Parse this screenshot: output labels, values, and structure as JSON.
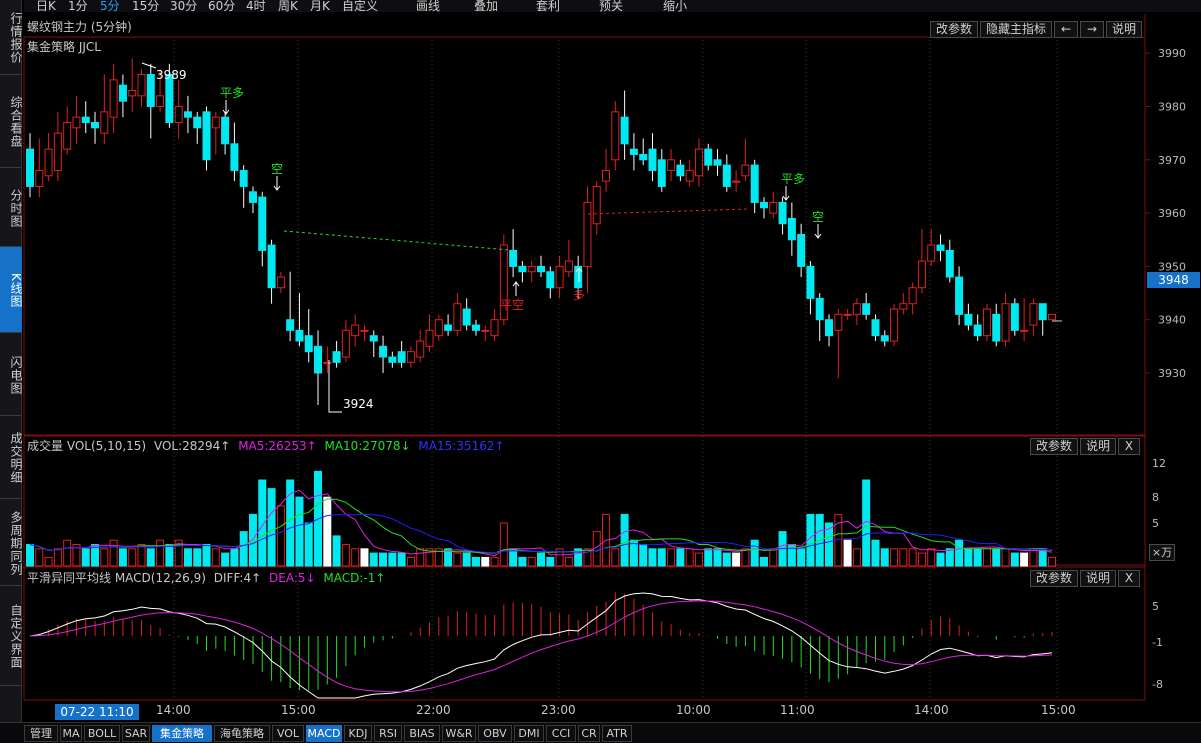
{
  "toolbar": {
    "items": [
      "日K",
      "1分",
      "5分",
      "15分",
      "30分",
      "60分",
      "4时",
      "周K",
      "月K",
      "自定义",
      "画线",
      "叠加",
      "套利",
      "预关",
      "缩小"
    ],
    "active": "5分"
  },
  "left_tabs": [
    "行情报价",
    "综合看盘",
    "分时图",
    "K线图",
    "闪电图",
    "成交明细",
    "多周期同列",
    "自定义界面"
  ],
  "left_active": "K线图",
  "main": {
    "title": "螺纹钢主力 (5分钟)",
    "strategy": "集金策略 JJCL",
    "buttons": [
      "改参数",
      "隐藏主指标",
      "←",
      "→",
      "说明"
    ],
    "current_price": "3948",
    "high_label": "3989",
    "low_label": "3924",
    "signals": {
      "pingduo": "平多",
      "kong": "空",
      "duo": "多",
      "pingkong": "平空"
    }
  },
  "volume": {
    "title": "成交量 VOL(5,10,15)",
    "vol": "VOL:28294↑",
    "ma5": "MA5:26253↑",
    "ma10": "MA10:27078↓",
    "ma15": "MA15:35162↑",
    "buttons": [
      "改参数",
      "说明",
      "X"
    ],
    "unit": "×万"
  },
  "macd": {
    "title": "平滑异同平均线 MACD(12,26,9)",
    "diff": "DIFF:4↑",
    "dea": "DEA:5↓",
    "macd": "MACD:-1↑",
    "buttons": [
      "改参数",
      "说明",
      "X"
    ]
  },
  "colors": {
    "up": "#e02020",
    "down": "#00e8f0",
    "ma5": "#e020e0",
    "ma10": "#20e020",
    "ma15": "#2020ff",
    "accent": "#1572c8"
  },
  "time_axis": {
    "badge": "07-22 11:10",
    "labels": [
      "14:00",
      "15:00",
      "22:00",
      "23:00",
      "10:00",
      "11:00",
      "14:00",
      "15:00"
    ]
  },
  "bottom_tabs": [
    "管理",
    "MA",
    "BOLL",
    "SAR",
    "集金策略",
    "海龟策略",
    "VOL",
    "MACD",
    "KDJ",
    "RSI",
    "BIAS",
    "W&R",
    "OBV",
    "DMI",
    "CCI",
    "CR",
    "ATR"
  ],
  "bottom_active": [
    "集金策略",
    "MACD"
  ],
  "chart_data": [
    {
      "type": "candlestick",
      "title": "螺纹钢主力 (5分钟)",
      "y_ticks": [
        3930,
        3940,
        3950,
        3960,
        3970,
        3980,
        3990
      ],
      "ylim": [
        3920,
        3992
      ],
      "x_labels": [
        "14:00",
        "15:00",
        "22:00",
        "23:00",
        "10:00",
        "11:00",
        "14:00",
        "15:00"
      ],
      "candles": [
        [
          3972,
          3965,
          3975,
          3963
        ],
        [
          3965,
          3968,
          3974,
          3963
        ],
        [
          3967,
          3972,
          3975,
          3966
        ],
        [
          3968,
          3975,
          3979,
          3966
        ],
        [
          3972,
          3977,
          3980,
          3971
        ],
        [
          3976,
          3978,
          3982,
          3973
        ],
        [
          3978,
          3977,
          3981,
          3975
        ],
        [
          3977,
          3976,
          3979,
          3973
        ],
        [
          3975,
          3979,
          3986,
          3973
        ],
        [
          3978,
          3985,
          3988,
          3975
        ],
        [
          3984,
          3981,
          3986,
          3978
        ],
        [
          3982,
          3983,
          3989,
          3979
        ],
        [
          3982,
          3986,
          3987,
          3980
        ],
        [
          3986,
          3980,
          3988,
          3974
        ],
        [
          3980,
          3982,
          3987,
          3979
        ],
        [
          3986,
          3977,
          3988,
          3976
        ],
        [
          3977,
          3980,
          3985,
          3974
        ],
        [
          3979,
          3978,
          3982,
          3975
        ],
        [
          3978,
          3976,
          3979,
          3973
        ],
        [
          3979,
          3970,
          3980,
          3968
        ],
        [
          3976,
          3978,
          3979,
          3971
        ],
        [
          3978,
          3973,
          3979,
          3971
        ],
        [
          3973,
          3968,
          3977,
          3966
        ],
        [
          3968,
          3965,
          3969,
          3961
        ],
        [
          3964,
          3962,
          3965,
          3960
        ],
        [
          3963,
          3953,
          3964,
          3950
        ],
        [
          3954,
          3946,
          3955,
          3943
        ],
        [
          3946,
          3948,
          3949,
          3945
        ],
        [
          3940,
          3938,
          3949,
          3936
        ],
        [
          3938,
          3936,
          3945,
          3935
        ],
        [
          3937,
          3934,
          3942,
          3932
        ],
        [
          3935,
          3930,
          3938,
          3924
        ],
        [
          3932,
          3932,
          3935,
          3930
        ],
        [
          3934,
          3932,
          3936,
          3931
        ],
        [
          3933,
          3938,
          3940,
          3932
        ],
        [
          3937,
          3939,
          3941,
          3935
        ],
        [
          3938,
          3938,
          3939,
          3936
        ],
        [
          3937,
          3936,
          3938,
          3933
        ],
        [
          3935,
          3933,
          3937,
          3930
        ],
        [
          3933,
          3932,
          3934,
          3931
        ],
        [
          3934,
          3932,
          3936,
          3931
        ],
        [
          3932,
          3934,
          3935,
          3931
        ],
        [
          3933,
          3936,
          3938,
          3932
        ],
        [
          3935,
          3938,
          3941,
          3934
        ],
        [
          3937,
          3940,
          3941,
          3936
        ],
        [
          3939,
          3938,
          3941,
          3937
        ],
        [
          3938,
          3943,
          3945,
          3937
        ],
        [
          3942,
          3939,
          3944,
          3938
        ],
        [
          3939,
          3938,
          3940,
          3937
        ],
        [
          3938,
          3938,
          3939,
          3936
        ],
        [
          3937,
          3940,
          3942,
          3936
        ],
        [
          3940,
          3954,
          3956,
          3939
        ],
        [
          3953,
          3950,
          3957,
          3948
        ],
        [
          3950,
          3949,
          3951,
          3947
        ],
        [
          3949,
          3950,
          3951,
          3947
        ],
        [
          3950,
          3949,
          3952,
          3948
        ],
        [
          3949,
          3946,
          3950,
          3944
        ],
        [
          3946,
          3950,
          3952,
          3944
        ],
        [
          3949,
          3951,
          3955,
          3948
        ],
        [
          3950,
          3946,
          3952,
          3944
        ],
        [
          3950,
          3962,
          3965,
          3945
        ],
        [
          3958,
          3965,
          3966,
          3956
        ],
        [
          3966,
          3968,
          3972,
          3964
        ],
        [
          3970,
          3979,
          3981,
          3968
        ],
        [
          3978,
          3973,
          3983,
          3970
        ],
        [
          3972,
          3971,
          3975,
          3968
        ],
        [
          3971,
          3970,
          3974,
          3969
        ],
        [
          3972,
          3968,
          3975,
          3966
        ],
        [
          3970,
          3965,
          3972,
          3964
        ],
        [
          3968,
          3970,
          3972,
          3966
        ],
        [
          3969,
          3967,
          3970,
          3966
        ],
        [
          3966,
          3968,
          3970,
          3965
        ],
        [
          3967,
          3972,
          3974,
          3965
        ],
        [
          3972,
          3969,
          3973,
          3968
        ],
        [
          3970,
          3969,
          3972,
          3967
        ],
        [
          3969,
          3965,
          3971,
          3964
        ],
        [
          3966,
          3966,
          3968,
          3964
        ],
        [
          3967,
          3969,
          3974,
          3966
        ],
        [
          3969,
          3962,
          3970,
          3960
        ],
        [
          3962,
          3961,
          3963,
          3959
        ],
        [
          3960,
          3962,
          3964,
          3959
        ],
        [
          3962,
          3958,
          3963,
          3956
        ],
        [
          3959,
          3955,
          3962,
          3952
        ],
        [
          3956,
          3950,
          3958,
          3948
        ],
        [
          3950,
          3944,
          3951,
          3941
        ],
        [
          3944,
          3940,
          3945,
          3936
        ],
        [
          3940,
          3937,
          3941,
          3935
        ],
        [
          3938,
          3941,
          3942,
          3929
        ],
        [
          3941,
          3941,
          3942,
          3940
        ],
        [
          3941,
          3943,
          3944,
          3939
        ],
        [
          3943,
          3941,
          3945,
          3940
        ],
        [
          3940,
          3937,
          3941,
          3936
        ],
        [
          3937,
          3936,
          3938,
          3935
        ],
        [
          3936,
          3942,
          3943,
          3935
        ],
        [
          3942,
          3943,
          3945,
          3941
        ],
        [
          3943,
          3946,
          3947,
          3941
        ],
        [
          3946,
          3951,
          3957,
          3945
        ],
        [
          3951,
          3954,
          3957,
          3950
        ],
        [
          3954,
          3953,
          3956,
          3951
        ],
        [
          3953,
          3948,
          3955,
          3947
        ],
        [
          3948,
          3941,
          3950,
          3939
        ],
        [
          3941,
          3939,
          3943,
          3938
        ],
        [
          3939,
          3937,
          3941,
          3936
        ],
        [
          3937,
          3942,
          3943,
          3936
        ],
        [
          3941,
          3936,
          3943,
          3935
        ],
        [
          3936,
          3943,
          3945,
          3935
        ],
        [
          3943,
          3938,
          3944,
          3937
        ],
        [
          3938,
          3938,
          3944,
          3936
        ],
        [
          3939,
          3943,
          3944,
          3937
        ],
        [
          3943,
          3940,
          3943,
          3937
        ],
        [
          3940,
          3941,
          3941,
          3940
        ]
      ]
    },
    {
      "type": "bar",
      "title": "成交量 VOL(5,10,15)",
      "y_ticks": [
        5,
        8,
        12
      ],
      "values": [
        2.5,
        2,
        1,
        2,
        3,
        2.5,
        2,
        2.5,
        2,
        3,
        2,
        2,
        2.5,
        2,
        3,
        2.5,
        3,
        2,
        2,
        2.5,
        2,
        1.5,
        2,
        4,
        6,
        10,
        9,
        7,
        10,
        8,
        5,
        11,
        8,
        3.5,
        2.5,
        2,
        2,
        1.5,
        1.5,
        1.5,
        1.5,
        1,
        2,
        2,
        2,
        2,
        1.5,
        1.5,
        1,
        1,
        1,
        5,
        2,
        1,
        1,
        1.5,
        1,
        2,
        1,
        2,
        2,
        4,
        6,
        2,
        6,
        3,
        2.5,
        2,
        2,
        2,
        2,
        2,
        1.5,
        2,
        2,
        1.5,
        1.5,
        2,
        3,
        1,
        2,
        4,
        2.5,
        2,
        6,
        6,
        5,
        6,
        3,
        2,
        10,
        3,
        2,
        2,
        2,
        2,
        1.5,
        2,
        1.5,
        2,
        3,
        2,
        2,
        2,
        2,
        2,
        1.5,
        1.5,
        2,
        2,
        1
      ]
    },
    {
      "type": "macd",
      "title": "平滑异同平均线 MACD(12,26,9)",
      "y_ticks": [
        5,
        -1,
        -8
      ]
    }
  ]
}
